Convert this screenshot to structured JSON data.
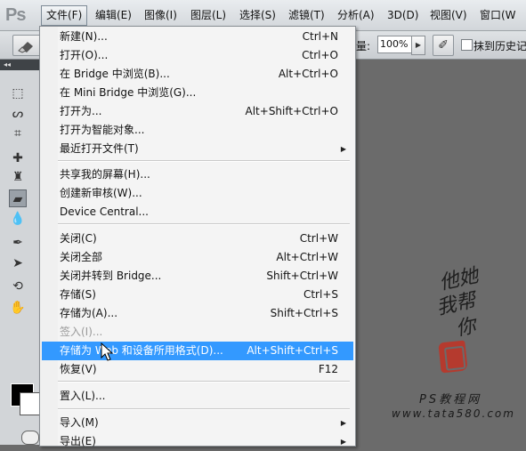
{
  "app": {
    "logo": "Ps"
  },
  "menubar": {
    "items": [
      "文件(F)",
      "编辑(E)",
      "图像(I)",
      "图层(L)",
      "选择(S)",
      "滤镜(T)",
      "分析(A)",
      "3D(D)",
      "视图(V)",
      "窗口(W"
    ]
  },
  "options": {
    "flow_label": "量:",
    "flow_value": "100%",
    "history_label": "抹到历史记"
  },
  "file_menu": [
    {
      "label": "新建(N)...",
      "shortcut": "Ctrl+N"
    },
    {
      "label": "打开(O)...",
      "shortcut": "Ctrl+O"
    },
    {
      "label": "在 Bridge 中浏览(B)...",
      "shortcut": "Alt+Ctrl+O"
    },
    {
      "label": "在 Mini Bridge 中浏览(G)...",
      "shortcut": ""
    },
    {
      "label": "打开为...",
      "shortcut": "Alt+Shift+Ctrl+O"
    },
    {
      "label": "打开为智能对象...",
      "shortcut": ""
    },
    {
      "label": "最近打开文件(T)",
      "shortcut": ""
    },
    {
      "label": "共享我的屏幕(H)...",
      "shortcut": ""
    },
    {
      "label": "创建新审核(W)...",
      "shortcut": ""
    },
    {
      "label": "Device Central...",
      "shortcut": ""
    },
    {
      "label": "关闭(C)",
      "shortcut": "Ctrl+W"
    },
    {
      "label": "关闭全部",
      "shortcut": "Alt+Ctrl+W"
    },
    {
      "label": "关闭并转到 Bridge...",
      "shortcut": "Shift+Ctrl+W"
    },
    {
      "label": "存储(S)",
      "shortcut": "Ctrl+S"
    },
    {
      "label": "存储为(A)...",
      "shortcut": "Shift+Ctrl+S"
    },
    {
      "label": "签入(I)...",
      "shortcut": ""
    },
    {
      "label": "存储为 Web 和设备所用格式(D)...",
      "shortcut": "Alt+Shift+Ctrl+S"
    },
    {
      "label": "恢复(V)",
      "shortcut": "F12"
    },
    {
      "label": "置入(L)...",
      "shortcut": ""
    },
    {
      "label": "导入(M)",
      "shortcut": ""
    },
    {
      "label": "导出(E)",
      "shortcut": ""
    }
  ],
  "watermark": {
    "line1": "他她",
    "line2": "我帮",
    "line3": "你",
    "site_cn": "PS教程网",
    "site_url": "www.tata580.com"
  }
}
